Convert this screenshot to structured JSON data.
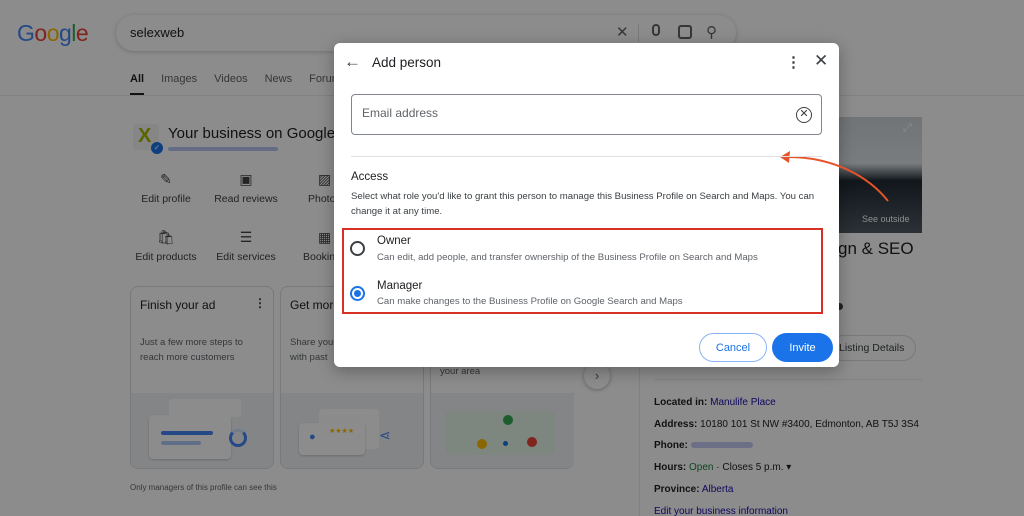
{
  "search": {
    "logo_text": "Google",
    "query": "selexweb",
    "tabs": [
      "All",
      "Images",
      "Videos",
      "News",
      "Forums"
    ]
  },
  "business": {
    "title": "Your business on Google",
    "actions": [
      "Edit profile",
      "Read reviews",
      "Photo",
      "Edit products",
      "Edit services",
      "Booking"
    ],
    "cards": [
      {
        "title": "Finish your ad",
        "desc": "Just a few more steps to reach more customers"
      },
      {
        "title": "Get more",
        "desc": "Share your with past"
      },
      {
        "title": "",
        "desc": "your area"
      }
    ],
    "footnote": "Only managers of this profile can see this"
  },
  "right_panel": {
    "see_outside": "See outside",
    "title": "gn & SEO",
    "listing_button": "Listing Details",
    "located_label": "Located in:",
    "located_value": "Manulife Place",
    "address_label": "Address:",
    "address_value": "10180 101 St NW #3400, Edmonton, AB T5J 3S4",
    "phone_label": "Phone:",
    "hours_label": "Hours:",
    "hours_status": "Open",
    "hours_close": "· Closes 5 p.m. ▾",
    "province_label": "Province:",
    "province_value": "Alberta",
    "edit_link": "Edit your business information"
  },
  "dialog": {
    "title": "Add person",
    "email_placeholder": "Email address",
    "access_heading": "Access",
    "access_desc": "Select what role you'd like to grant this person to manage this Business Profile on Search and Maps. You can change it at any time.",
    "roles": [
      {
        "name": "Owner",
        "desc": "Can edit, add people, and transfer ownership of the Business Profile on Search and Maps",
        "selected": false
      },
      {
        "name": "Manager",
        "desc": "Can make changes to the Business Profile on Google Search and Maps",
        "selected": true
      }
    ],
    "cancel_label": "Cancel",
    "invite_label": "Invite"
  },
  "colors": {
    "accent": "#1a73e8",
    "highlight": "#d93025",
    "annotation_arrow": "#e8542a"
  }
}
